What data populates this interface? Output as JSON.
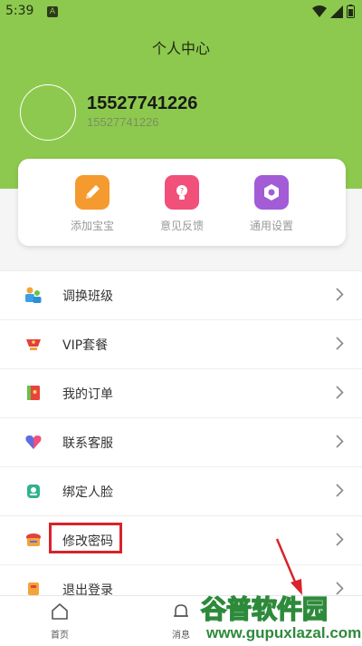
{
  "status_bar": {
    "time": "5:39",
    "notification_letter": "A"
  },
  "header": {
    "title": "个人中心"
  },
  "user": {
    "name": "15527741226",
    "subtitle": "15527741226"
  },
  "quick_actions": [
    {
      "label": "添加宝宝",
      "icon": "pencil-icon",
      "color": "#f59a2e"
    },
    {
      "label": "意见反馈",
      "icon": "lightbulb-icon",
      "color": "#f0507a"
    },
    {
      "label": "通用设置",
      "icon": "gear-icon",
      "color": "#a35bd6"
    }
  ],
  "menu": [
    {
      "label": "调换班级",
      "icon": "class-switch-icon"
    },
    {
      "label": "VIP套餐",
      "icon": "vip-cup-icon"
    },
    {
      "label": "我的订单",
      "icon": "order-book-icon"
    },
    {
      "label": "联系客服",
      "icon": "heart-support-icon"
    },
    {
      "label": "绑定人脸",
      "icon": "face-bind-icon"
    },
    {
      "label": "修改密码",
      "icon": "password-icon"
    },
    {
      "label": "退出登录",
      "icon": "logout-icon"
    }
  ],
  "bottom_nav": [
    {
      "label": "首页",
      "icon": "home-icon"
    },
    {
      "label": "消息",
      "icon": "bell-icon"
    }
  ],
  "watermark": {
    "title": "谷普软件园",
    "url": "www.gupuxlazal.com"
  },
  "colors": {
    "header_green": "#8dc94e",
    "highlight_red": "#d8232a"
  }
}
